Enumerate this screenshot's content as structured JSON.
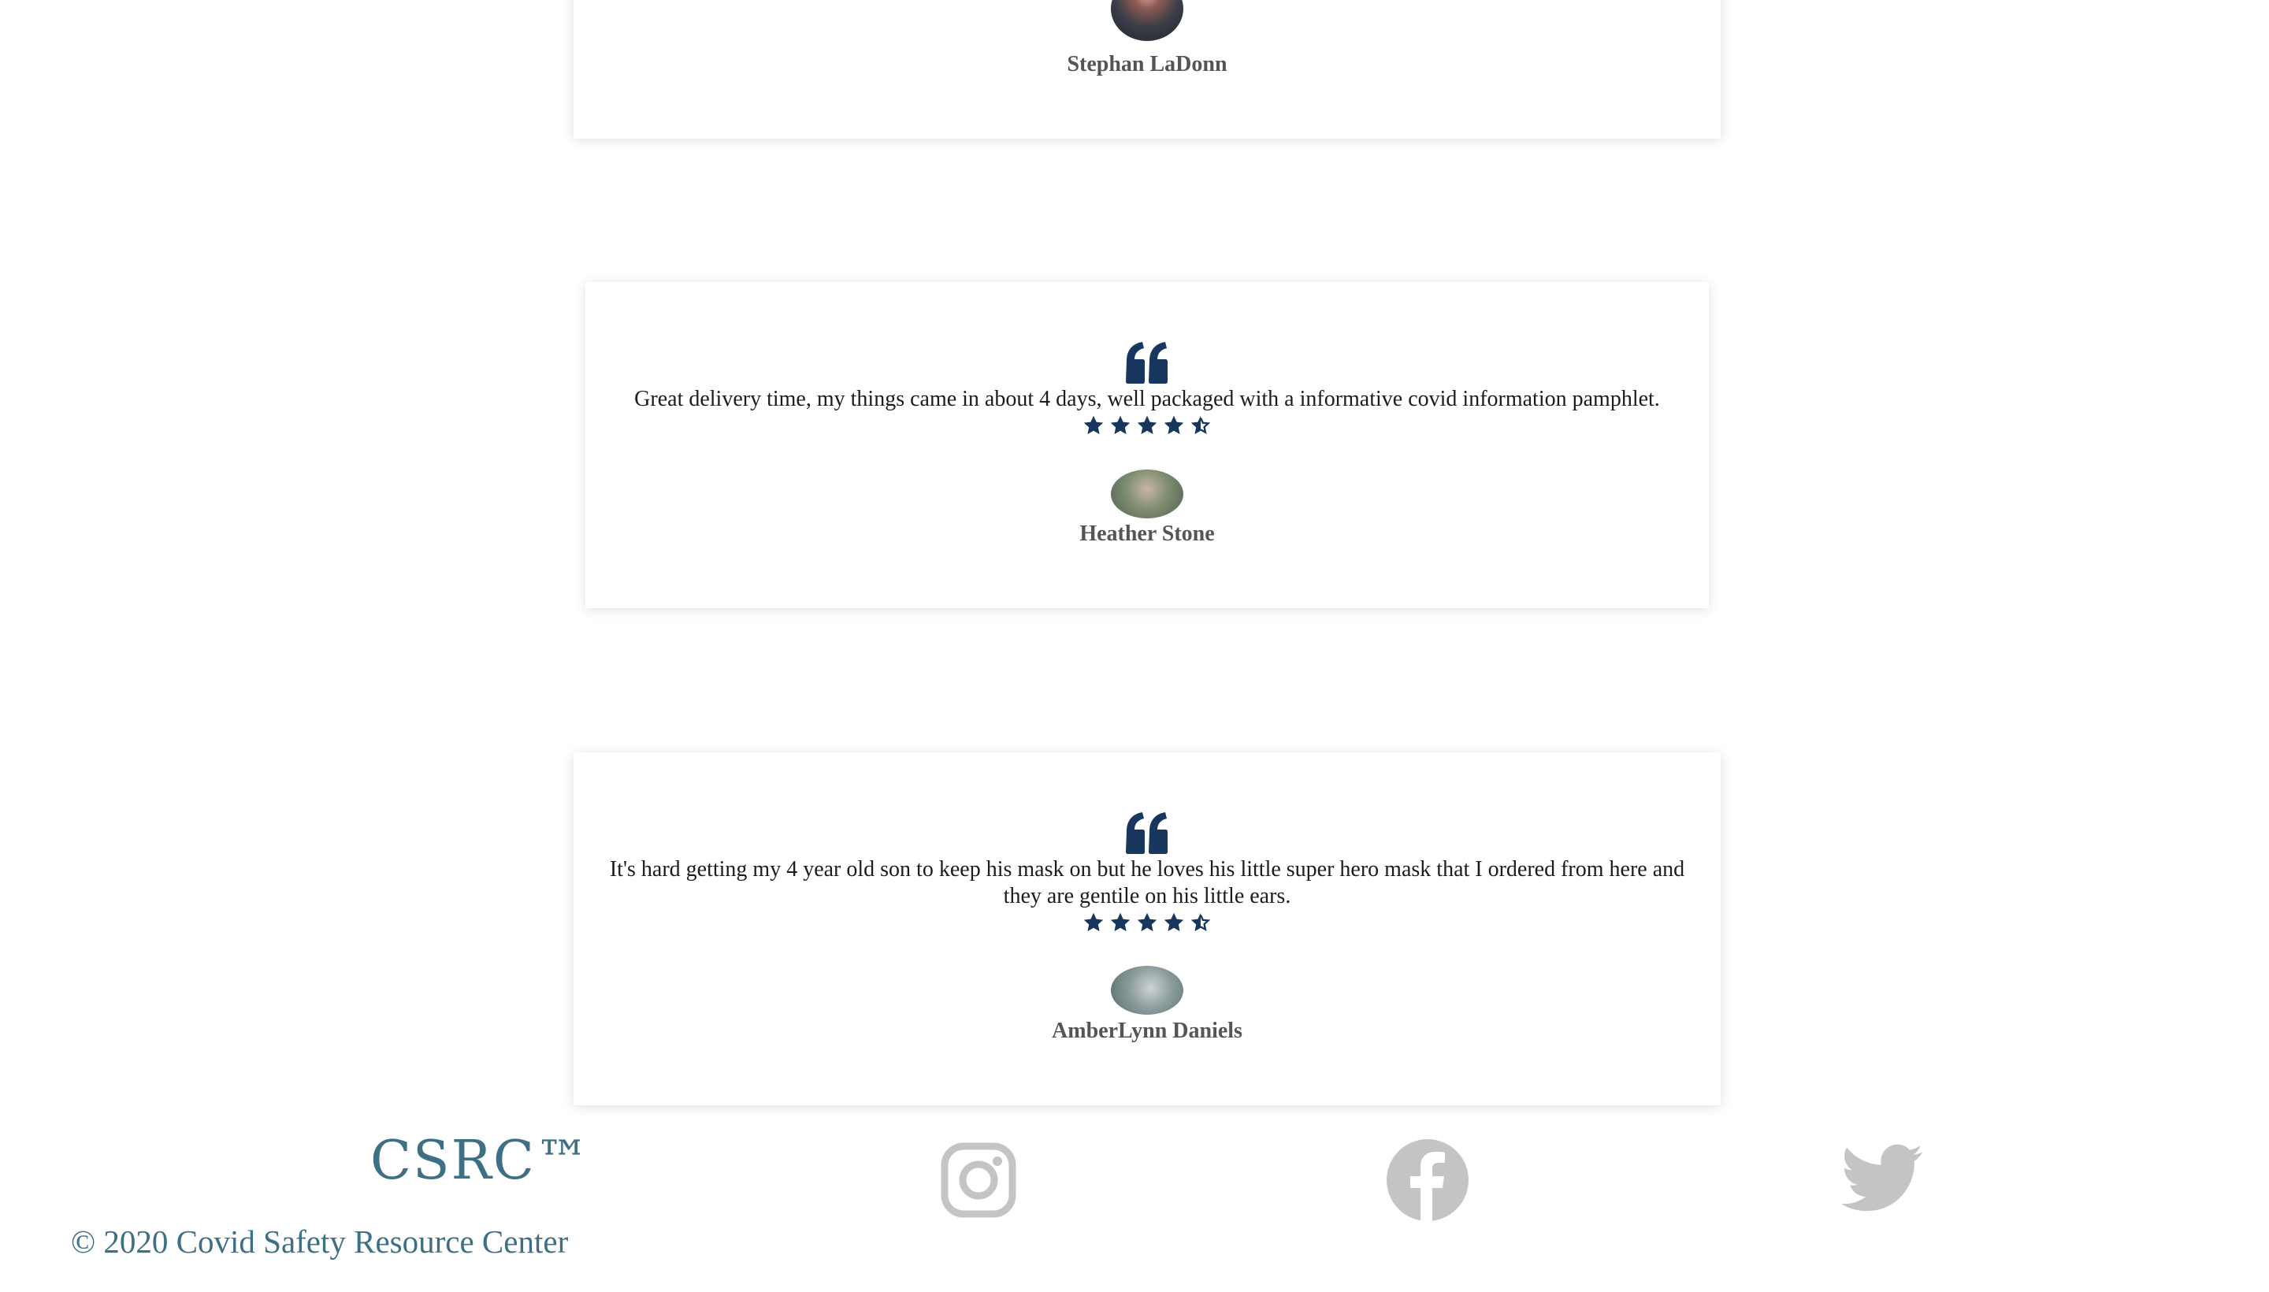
{
  "colors": {
    "accent_navy": "#17375e",
    "footer_teal": "#3d6f85",
    "social_gray": "#c4c4c4",
    "text_dark": "#1c1c1c",
    "name_gray": "#555555"
  },
  "testimonials": [
    {
      "reviewer": "Stephan LaDonn"
    },
    {
      "text": "Great delivery time, my things came in about 4 days, well packaged with a informative covid information pamphlet.",
      "rating": 4.5,
      "reviewer": "Heather Stone"
    },
    {
      "text": "It's hard getting my 4 year old son to keep his mask on but he loves his little super hero mask that I ordered from here and they are gentile on his little ears.",
      "rating": 4.5,
      "reviewer": "AmberLynn Daniels"
    }
  ],
  "footer": {
    "logo": "CSRC™",
    "copyright": "© 2020 Covid Safety Resource Center",
    "social_icons": [
      "instagram-icon",
      "facebook-icon",
      "twitter-icon"
    ]
  }
}
